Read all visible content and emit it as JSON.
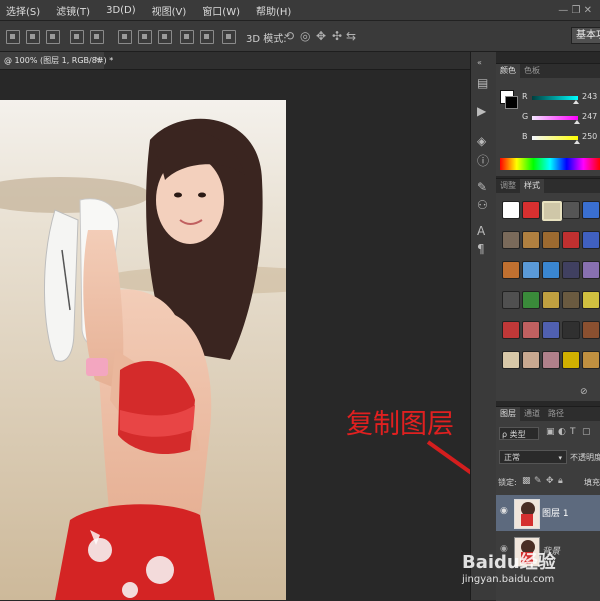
{
  "menu": {
    "items": [
      "选择(S)",
      "滤镜(T)",
      "3D(D)",
      "视图(V)",
      "窗口(W)",
      "帮助(H)"
    ],
    "window_controls": "— ❐ ✕"
  },
  "options_bar": {
    "mode_3d_label": "3D 模式:",
    "workspace_button": "基本功"
  },
  "document_tab": {
    "label": "@ 100% (图层 1, RGB/8#) *",
    "close": "×"
  },
  "color_panel": {
    "tabs": [
      "颜色",
      "色板"
    ],
    "sliders": [
      {
        "label": "R",
        "value": "243",
        "fill": 0.953,
        "color": "#00ffff"
      },
      {
        "label": "G",
        "value": "247",
        "fill": 0.969,
        "color": "#ff00ff"
      },
      {
        "label": "B",
        "value": "250",
        "fill": 0.98,
        "color": "#ffff00"
      }
    ]
  },
  "styles_panel": {
    "tabs": [
      "调整",
      "样式"
    ]
  },
  "layers_panel": {
    "tabs": [
      "图层",
      "通道",
      "路径"
    ],
    "filter_label": "ρ 类型",
    "blend_mode": "正常",
    "opacity_label": "不透明度",
    "lock_label": "锁定:",
    "fill_label": "填充",
    "layers": [
      {
        "name": "图层 1",
        "selected": true
      },
      {
        "name": "背景",
        "selected": false
      }
    ]
  },
  "annotation": {
    "text": "复制图层",
    "color": "#e02020"
  },
  "watermark": {
    "line1": "Baidu经验",
    "line2": "jingyan.baidu.com"
  }
}
